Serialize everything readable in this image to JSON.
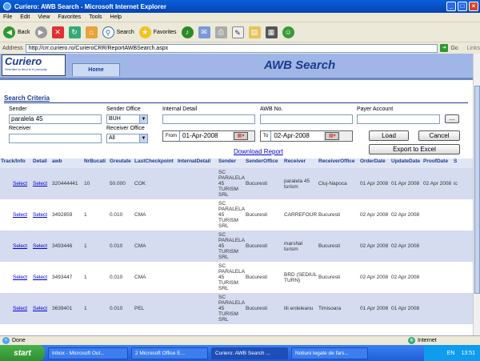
{
  "window": {
    "title": "Curiero: AWB Search - Microsoft Internet Explorer"
  },
  "menu": [
    "File",
    "Edit",
    "View",
    "Favorites",
    "Tools",
    "Help"
  ],
  "toolbar": {
    "back": "Back",
    "search": "Search",
    "favorites": "Favorites"
  },
  "address": {
    "label": "Address",
    "url": "http://crr.curiero.ro/CurieroCRR/ReportAWBSearch.aspx",
    "go": "Go",
    "links": "Links"
  },
  "header": {
    "logo": "Curiero",
    "tagline": "Oriented to tend to it promptly",
    "home_tab": "Home",
    "page_title": "AWB Search"
  },
  "criteria": {
    "title": "Search Criteria",
    "sender_label": "Sender",
    "sender_value": "paralela 45",
    "sender_office_label": "Sender Office",
    "sender_office_value": "BUH",
    "internal_detail_label": "Internal Detail",
    "awb_label": "AWB No.",
    "payer_label": "Payer Account",
    "payer_btn": "...",
    "receiver_label": "Receiver",
    "receiver_office_label": "Receiver Office",
    "receiver_office_value": "All",
    "from_label": "From",
    "from_value": "01-Apr-2008",
    "to_label": "To",
    "to_value": "02-Apr-2008",
    "load": "Load",
    "cancel": "Cancel",
    "export": "Export to Excel",
    "download": "Download Report"
  },
  "table": {
    "columns": [
      "Track/Info",
      "Detail",
      "awb",
      "NrBucati",
      "Greutate",
      "LastCheckpoint",
      "InternalDetail",
      "Sender",
      "SenderOffice",
      "Receiver",
      "ReceiverOffice",
      "OrderDate",
      "UpdateDate",
      "ProofDate",
      "S"
    ],
    "rows": [
      {
        "track": "Select",
        "detail": "Select",
        "awb": "320444441",
        "nr": "10",
        "gr": "50.000",
        "cp": "COK",
        "sender": "SC PARALELA 45 TURISM SRL",
        "so": "Bucuresti",
        "recv": "paralela 45 turism",
        "ro": "Cluj-Napoca",
        "od": "01 Apr 2008",
        "ud": "01 Apr 2008",
        "pd": "02 Apr 2008",
        "s": "ic"
      },
      {
        "track": "Select",
        "detail": "Select",
        "awb": "3492859",
        "nr": "1",
        "gr": "0.010",
        "cp": "CMA",
        "sender": "SC PARALELA 45 TURISM SRL",
        "so": "Bucuresti",
        "recv": "CARREFOUR",
        "ro": "Bucuresti",
        "od": "02 Apr 2008",
        "ud": "02 Apr 2008",
        "pd": "",
        "s": ""
      },
      {
        "track": "Select",
        "detail": "Select",
        "awb": "3493446",
        "nr": "1",
        "gr": "0.010",
        "cp": "CMA",
        "sender": "SC PARALELA 45 TURISM SRL",
        "so": "Bucuresti",
        "recv": "marshal turism",
        "ro": "Bucuresti",
        "od": "02 Apr 2008",
        "ud": "02 Apr 2008",
        "pd": "",
        "s": ""
      },
      {
        "track": "Select",
        "detail": "Select",
        "awb": "3493447",
        "nr": "1",
        "gr": "0.010",
        "cp": "CMA",
        "sender": "SC PARALELA 45 TURISM SRL",
        "so": "Bucuresti",
        "recv": "BRD (SEDIUL TURN)",
        "ro": "Bucuresti",
        "od": "02 Apr 2008",
        "ud": "02 Apr 2008",
        "pd": "",
        "s": ""
      },
      {
        "track": "Select",
        "detail": "Select",
        "awb": "3639401",
        "nr": "1",
        "gr": "0.010",
        "cp": "PEL",
        "sender": "SC PARALELA 45 TURISM SRL",
        "so": "Bucuresti",
        "recv": "lili erdeleanu",
        "ro": "Timisoara",
        "od": "01 Apr 2008",
        "ud": "01 Apr 2008",
        "pd": "",
        "s": ""
      }
    ]
  },
  "status": {
    "left": "Done",
    "zone": "Internet"
  },
  "taskbar": {
    "start": "start",
    "tasks": [
      "Inbox - Microsoft Out...",
      "2 Microsoft Office E...",
      "Curiero: AWB Search ...",
      "Notiuni legate de fars..."
    ],
    "lang": "EN",
    "time": "13:51"
  }
}
